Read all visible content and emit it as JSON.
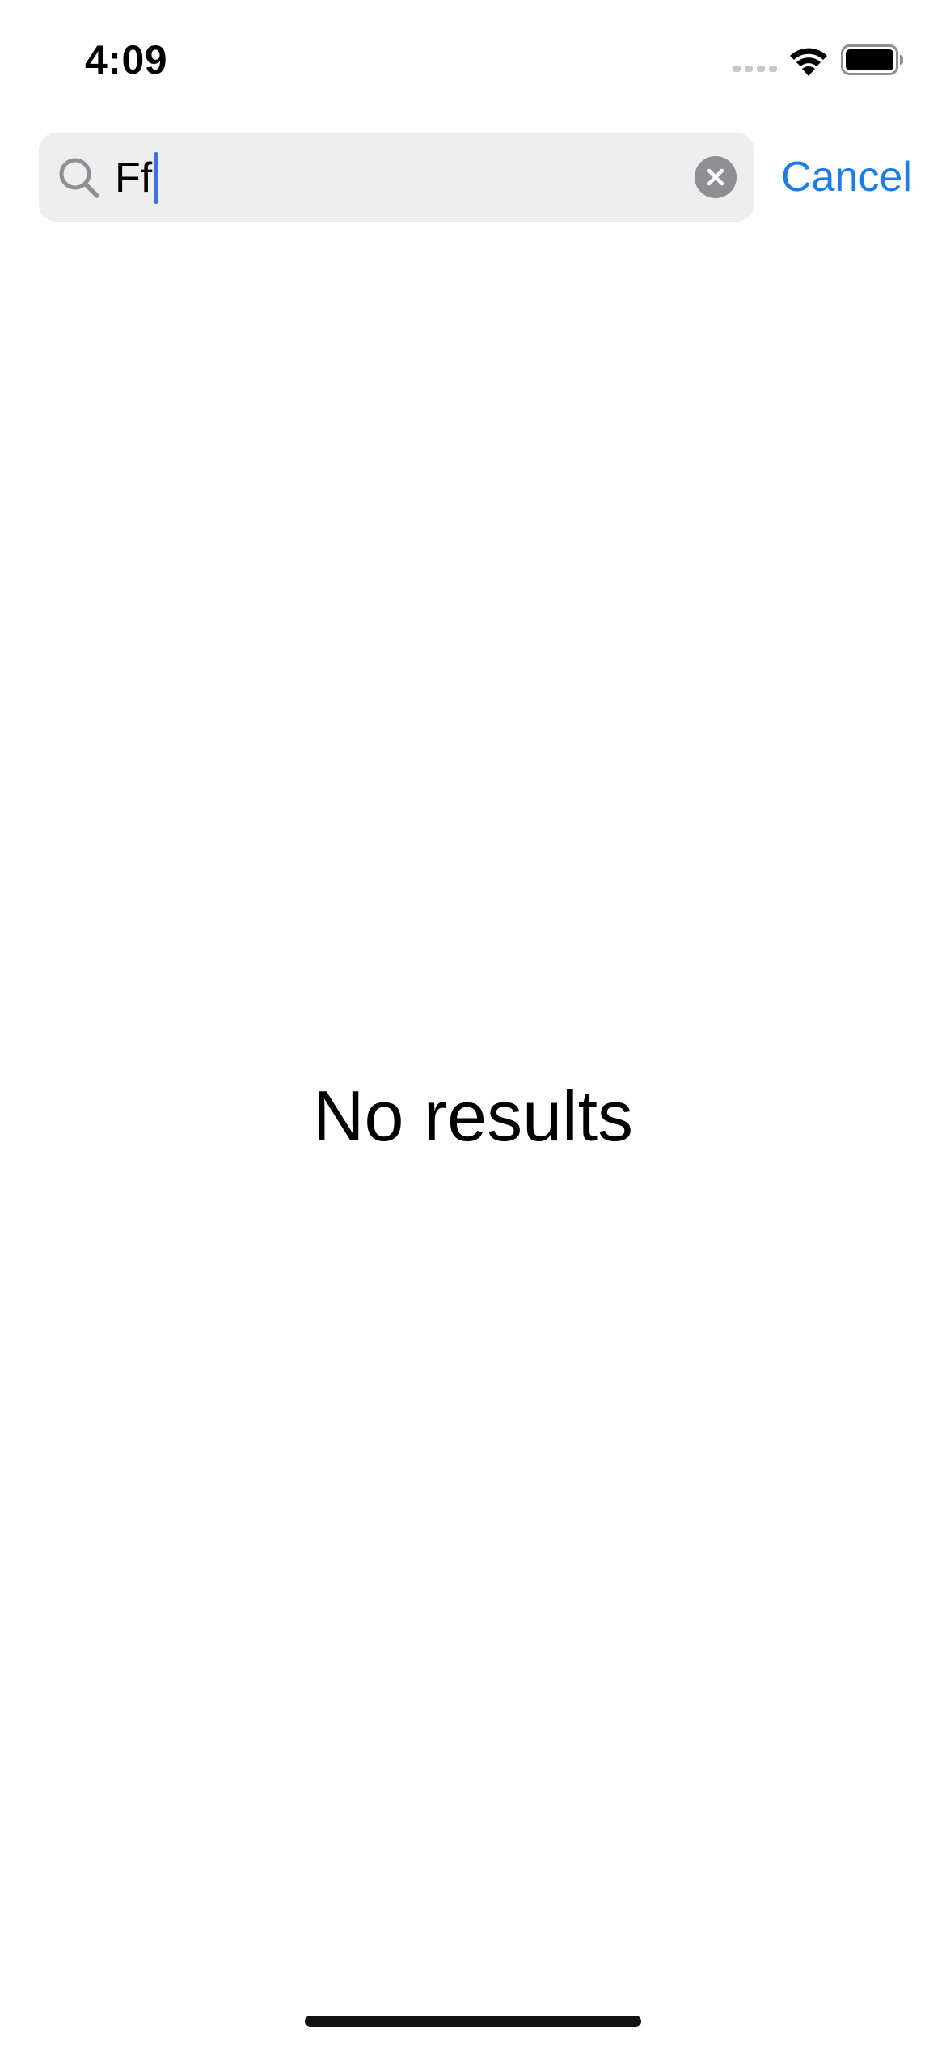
{
  "status_bar": {
    "time": "4:09",
    "icons": [
      "cellular-signal-icon",
      "wifi-icon",
      "battery-icon"
    ]
  },
  "search": {
    "value": "Ff",
    "icon": "search-icon",
    "clear_icon": "clear-icon",
    "cancel_label": "Cancel"
  },
  "results": {
    "empty_message": "No results"
  },
  "colors": {
    "accent": "#1a7cf5",
    "caret": "#3a6ff0",
    "search_field_bg": "#eeeeef",
    "clear_button_bg": "#8e8e93"
  }
}
